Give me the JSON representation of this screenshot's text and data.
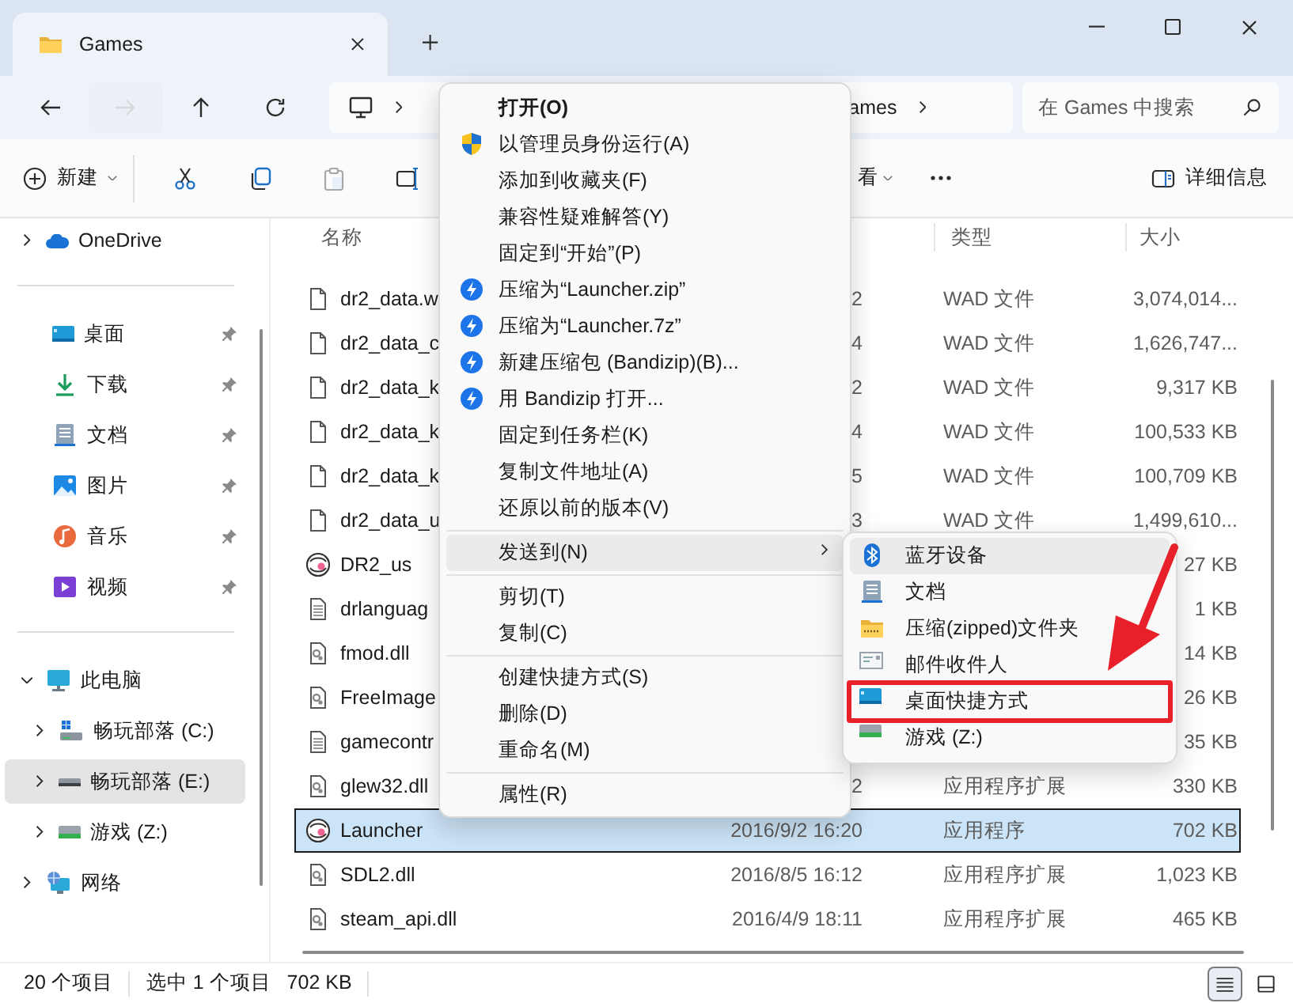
{
  "window": {
    "title": "Games"
  },
  "nav": {
    "buttons": [
      {
        "kind": "back",
        "disabled": false
      },
      {
        "kind": "forward",
        "disabled": true
      },
      {
        "kind": "up",
        "disabled": false
      },
      {
        "kind": "refresh",
        "disabled": false
      }
    ],
    "breadcrumbs": [
      "ames"
    ],
    "search": {
      "placeholder": "在 Games 中搜索"
    }
  },
  "toolbar": {
    "items": [
      {
        "kind": "new",
        "label": "新建",
        "disabled": false
      },
      {
        "kind": "cut",
        "disabled": false
      },
      {
        "kind": "copy",
        "disabled": false
      },
      {
        "kind": "paste",
        "disabled": true
      },
      {
        "kind": "rename",
        "disabled": false
      },
      {
        "kind": "view",
        "label": "看",
        "disabled": false
      },
      {
        "kind": "more",
        "disabled": false
      }
    ],
    "details": {
      "label": "详细信息"
    }
  },
  "sidebar": {
    "top": [
      {
        "label": "OneDrive",
        "kind": "cloud",
        "expanded": false,
        "selected": false
      }
    ],
    "pinned": [
      {
        "label": "桌面",
        "kind": "desktop",
        "pinned": true
      },
      {
        "label": "下载",
        "kind": "download",
        "pinned": true
      },
      {
        "label": "文档",
        "kind": "document",
        "pinned": true
      },
      {
        "label": "图片",
        "kind": "pictures",
        "pinned": true
      },
      {
        "label": "音乐",
        "kind": "music",
        "pinned": true
      },
      {
        "label": "视频",
        "kind": "video",
        "pinned": true
      }
    ],
    "tree": [
      {
        "label": "此电脑",
        "kind": "pc",
        "expanded": true,
        "selected": false,
        "children": [
          {
            "label": "畅玩部落 (C:)",
            "kind": "systemdrive",
            "expanded": false,
            "selected": false
          },
          {
            "label": "畅玩部落 (E:)",
            "kind": "drive",
            "expanded": false,
            "selected": true
          },
          {
            "label": "游戏 (Z:)",
            "kind": "netdrive",
            "expanded": false,
            "selected": false
          }
        ]
      },
      {
        "label": "网络",
        "kind": "network",
        "expanded": false,
        "selected": false
      }
    ]
  },
  "file_list": {
    "columns": {
      "name": "名称",
      "type": "类型",
      "size": "大小"
    },
    "rows": [
      {
        "name": "dr2_data.w",
        "date": "2",
        "type": "WAD 文件",
        "size": "3,074,014...",
        "kind": "file",
        "selected": false
      },
      {
        "name": "dr2_data_c",
        "date": "4",
        "type": "WAD 文件",
        "size": "1,626,747...",
        "kind": "file",
        "selected": false
      },
      {
        "name": "dr2_data_k",
        "date": "2",
        "type": "WAD 文件",
        "size": "9,317 KB",
        "kind": "file",
        "selected": false
      },
      {
        "name": "dr2_data_k",
        "date": "4",
        "type": "WAD 文件",
        "size": "100,533 KB",
        "kind": "file",
        "selected": false
      },
      {
        "name": "dr2_data_k",
        "date": "5",
        "type": "WAD 文件",
        "size": "100,709 KB",
        "kind": "file",
        "selected": false
      },
      {
        "name": "dr2_data_u",
        "date": "3",
        "type": "WAD 文件",
        "size": "1,499,610...",
        "kind": "file",
        "selected": false
      },
      {
        "name": "DR2_us",
        "size": "27 KB",
        "kind": "app",
        "selected": false
      },
      {
        "name": "drlanguag",
        "size": "1 KB",
        "kind": "text",
        "selected": false
      },
      {
        "name": "fmod.dll",
        "size": "14 KB",
        "kind": "dll",
        "selected": false
      },
      {
        "name": "FreeImage",
        "size": "26 KB",
        "kind": "dll",
        "selected": false
      },
      {
        "name": "gamecontr",
        "size": "35 KB",
        "kind": "text",
        "selected": false
      },
      {
        "name": "glew32.dll",
        "date": "2",
        "type": "应用程序扩展",
        "size": "330 KB",
        "kind": "dll",
        "selected": false
      },
      {
        "name": "Launcher",
        "date": "2016/9/2 16:20",
        "type": "应用程序",
        "size": "702 KB",
        "kind": "app",
        "selected": true
      },
      {
        "name": "SDL2.dll",
        "date": "2016/8/5 16:12",
        "type": "应用程序扩展",
        "size": "1,023 KB",
        "kind": "dll",
        "selected": false
      },
      {
        "name": "steam_api.dll",
        "date": "2016/4/9 18:11",
        "type": "应用程序扩展",
        "size": "465 KB",
        "kind": "dll",
        "selected": false
      }
    ]
  },
  "status_bar": {
    "count": "20 个项目",
    "selection": "选中 1 个项目",
    "selection_size": "702 KB",
    "views": [
      {
        "kind": "details",
        "selected": true
      },
      {
        "kind": "tiles",
        "selected": false
      }
    ]
  },
  "context_menu": {
    "items": [
      {
        "kind": "plain",
        "label": "打开(O)",
        "bold": true,
        "selected": false,
        "submenu": false
      },
      {
        "kind": "admin",
        "label": "以管理员身份运行(A)",
        "bold": false,
        "selected": false,
        "submenu": false
      },
      {
        "kind": "plain",
        "label": "添加到收藏夹(F)",
        "bold": false,
        "selected": false,
        "submenu": false
      },
      {
        "kind": "plain",
        "label": "兼容性疑难解答(Y)",
        "bold": false,
        "selected": false,
        "submenu": false
      },
      {
        "kind": "plain",
        "label": "固定到“开始”(P)",
        "bold": false,
        "selected": false,
        "submenu": false
      },
      {
        "kind": "archive",
        "label": "压缩为“Launcher.zip”",
        "bold": false,
        "selected": false,
        "submenu": false
      },
      {
        "kind": "archive",
        "label": "压缩为“Launcher.7z”",
        "bold": false,
        "selected": false,
        "submenu": false
      },
      {
        "kind": "archive",
        "label": "新建压缩包 (Bandizip)(B)...",
        "bold": false,
        "selected": false,
        "submenu": false
      },
      {
        "kind": "archive",
        "label": "用 Bandizip 打开...",
        "bold": false,
        "selected": false,
        "submenu": false
      },
      {
        "kind": "plain",
        "label": "固定到任务栏(K)",
        "bold": false,
        "selected": false,
        "submenu": false
      },
      {
        "kind": "plain",
        "label": "复制文件地址(A)",
        "bold": false,
        "selected": false,
        "submenu": false
      },
      {
        "kind": "plain",
        "label": "还原以前的版本(V)",
        "bold": false,
        "selected": false,
        "submenu": false
      },
      {
        "kind": "separator"
      },
      {
        "kind": "plain",
        "label": "发送到(N)",
        "bold": false,
        "selected": true,
        "submenu": true
      },
      {
        "kind": "separator"
      },
      {
        "kind": "plain",
        "label": "剪切(T)",
        "bold": false,
        "selected": false,
        "submenu": false
      },
      {
        "kind": "plain",
        "label": "复制(C)",
        "bold": false,
        "selected": false,
        "submenu": false
      },
      {
        "kind": "separator"
      },
      {
        "kind": "plain",
        "label": "创建快捷方式(S)",
        "bold": false,
        "selected": false,
        "submenu": false
      },
      {
        "kind": "plain",
        "label": "删除(D)",
        "bold": false,
        "selected": false,
        "submenu": false
      },
      {
        "kind": "plain",
        "label": "重命名(M)",
        "bold": false,
        "selected": false,
        "submenu": false
      },
      {
        "kind": "separator"
      },
      {
        "kind": "plain",
        "label": "属性(R)",
        "bold": false,
        "selected": false,
        "submenu": false
      }
    ]
  },
  "submenu": {
    "items": [
      {
        "label": "蓝牙设备",
        "kind": "bluetooth",
        "selected": true,
        "marked": false
      },
      {
        "label": "文档",
        "kind": "documents",
        "selected": false,
        "marked": false
      },
      {
        "label": "压缩(zipped)文件夹",
        "kind": "zip",
        "selected": false,
        "marked": false
      },
      {
        "label": "邮件收件人",
        "kind": "mail",
        "selected": false,
        "marked": false
      },
      {
        "label": "桌面快捷方式",
        "kind": "desktop",
        "selected": false,
        "marked": true
      },
      {
        "label": "游戏 (Z:)",
        "kind": "netdrive",
        "selected": false,
        "marked": false
      }
    ]
  }
}
